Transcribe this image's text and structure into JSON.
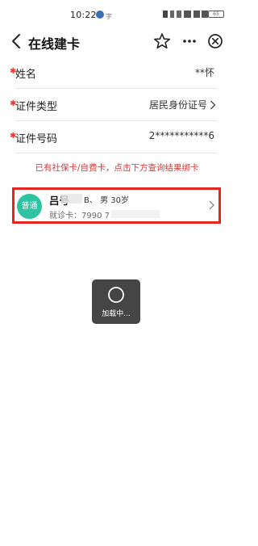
{
  "status_bar": {
    "time": "10:22",
    "carrier_glyph": "字",
    "battery": "65"
  },
  "nav": {
    "title": "在线建卡",
    "icons": [
      "back-icon",
      "star-icon",
      "more-icon",
      "close-icon"
    ]
  },
  "form": {
    "name": {
      "label": "姓名",
      "value": "**怀"
    },
    "id_type": {
      "label": "证件类型",
      "value": "居民身份证号"
    },
    "id_number": {
      "label": "证件号码",
      "value": "2***********6"
    }
  },
  "notice": "已有社保卡/自费卡，点击下方查询结果绑卡",
  "card": {
    "badge": "普通",
    "name": "吕号",
    "name_suffix": "B、",
    "gender_age": "男 30岁",
    "number": "就诊卡：7990   7"
  },
  "loading": {
    "text": "加载中..."
  },
  "colors": {
    "required_star": "#e53935",
    "notice": "#d23a3a",
    "card_border": "#e5251f",
    "badge": "#2ec4a3",
    "toast": "#454545"
  }
}
